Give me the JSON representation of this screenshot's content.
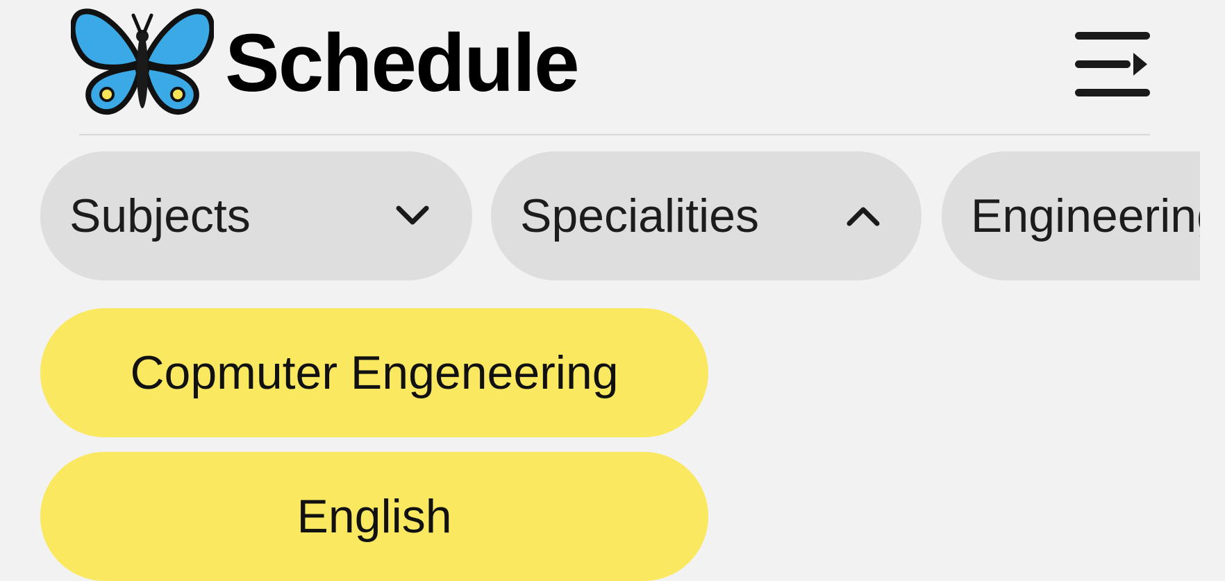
{
  "app": {
    "title": "Schedule",
    "logo_icon": "butterfly-icon",
    "menu_icon": "menu-collapse-icon"
  },
  "filters": {
    "chips": [
      {
        "label": "Subjects",
        "chevron": "chevron-down-icon",
        "expanded": false
      },
      {
        "label": "Specialities",
        "chevron": "chevron-up-icon",
        "expanded": true
      },
      {
        "label": "Engineering",
        "chevron": "",
        "expanded": false
      }
    ]
  },
  "dropdown": {
    "options": [
      {
        "label": "Copmuter Engeneering"
      },
      {
        "label": "English"
      }
    ]
  },
  "colors": {
    "background": "#f2f2f2",
    "chip": "#dedede",
    "option": "#fae960",
    "butterfly": "#3ba9e6"
  }
}
